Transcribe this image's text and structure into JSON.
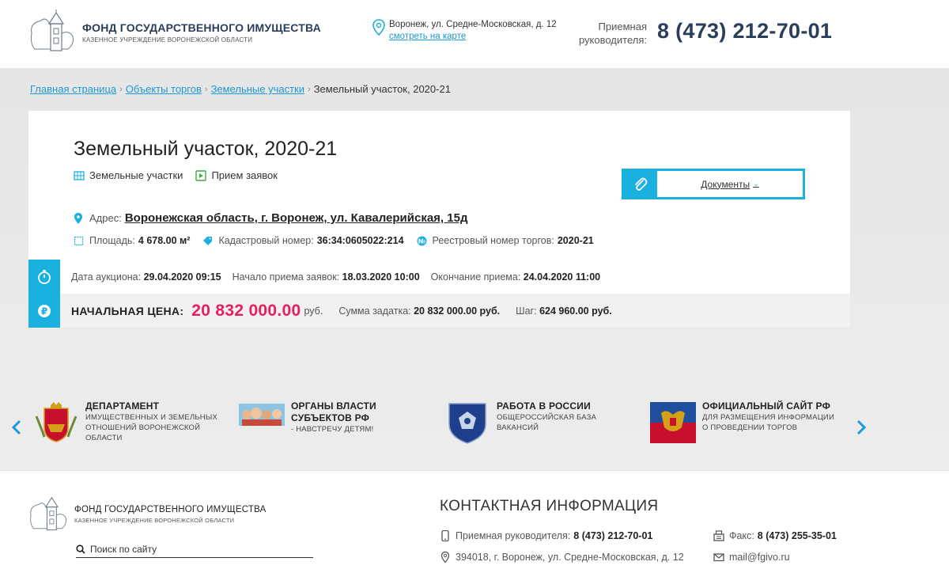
{
  "header": {
    "org_title": "ФОНД ГОСУДАРСТВЕННОГО ИМУЩЕСТВА",
    "org_subtitle": "КАЗЕННОЕ УЧРЕЖДЕНИЕ ВОРОНЕЖСКОЙ ОБЛАСТИ",
    "address": "Воронеж, ул. Средне-Московская, д. 12",
    "map_link": "смотреть на карте",
    "phone_label_1": "Приемная",
    "phone_label_2": "руководителя:",
    "phone": "8 (473) 212-70-01"
  },
  "breadcrumb": {
    "items": [
      "Главная страница",
      "Объекты торгов",
      "Земельные участки"
    ],
    "current": "Земельный участок, 2020-21"
  },
  "lot": {
    "title": "Земельный участок, 2020-21",
    "tags": [
      "Земельные участки",
      "Прием заявок"
    ],
    "docs_label": "Документы",
    "address_label": "Адрес:",
    "address": "Воронежская область, г. Воронеж, ул. Кавалерийская, 15д",
    "area_label": "Площадь:",
    "area": "4 678.00 м²",
    "cadastral_label": "Кадастровый номер:",
    "cadastral": "36:34:0605022:214",
    "registry_label": "Реестровый номер торгов:",
    "registry": "2020-21",
    "auction_date_label": "Дата аукциона:",
    "auction_date": "29.04.2020 09:15",
    "start_label": "Начало приема заявок:",
    "start": "18.03.2020 10:00",
    "end_label": "Окончание приема:",
    "end": "24.04.2020 11:00",
    "price_label": "НАЧАЛЬНАЯ ЦЕНА:",
    "price": "20 832 000.00",
    "currency": "руб.",
    "deposit_label": "Сумма задатка:",
    "deposit": "20 832 000.00 руб.",
    "step_label": "Шаг:",
    "step": "624 960.00 руб."
  },
  "partners": [
    {
      "title_1": "ДЕПАРТАМЕНТ",
      "sub": [
        "ИМУЩЕСТВЕННЫХ И ЗЕМЕЛЬНЫХ",
        "ОТНОШЕНИЙ ВОРОНЕЖСКОЙ",
        "ОБЛАСТИ"
      ]
    },
    {
      "title_1": "ОРГАНЫ ВЛАСТИ",
      "title_2": "СУБЪЕКТОВ РФ",
      "sub": [
        "- НАВСТРЕЧУ ДЕТЯМ!"
      ]
    },
    {
      "title_1": "РАБОТА В РОССИИ",
      "sub": [
        "ОБЩЕРОССИЙСКАЯ БАЗА",
        "ВАКАНСИЙ"
      ]
    },
    {
      "title_1": "ОФИЦИАЛЬНЫЙ САЙТ РФ",
      "sub": [
        "ДЛЯ РАЗМЕЩЕНИЯ ИНФОРМАЦИИ",
        "О ПРОВЕДЕНИИ ТОРГОВ"
      ]
    }
  ],
  "footer": {
    "org_title": "ФОНД ГОСУДАРСТВЕННОГО ИМУЩЕСТВА",
    "org_subtitle": "КАЗЕННОЕ УЧРЕЖДЕНИЕ ВОРОНЕЖСКОЙ ОБЛАСТИ",
    "search_placeholder": "Поиск по сайту",
    "contacts_title": "КОНТАКТНАЯ ИНФОРМАЦИЯ",
    "reception_label": "Приемная руководителя:",
    "reception_phone": "8 (473) 212-70-01",
    "fax_label": "Факс:",
    "fax": "8 (473) 255-35-01",
    "address": "394018, г. Воронеж, ул. Средне-Московская, д. 12",
    "email": "mail@fgivo.ru"
  },
  "colors": {
    "accent": "#1ab0e0",
    "price": "#e6205e",
    "brand": "#2a3e5c"
  }
}
